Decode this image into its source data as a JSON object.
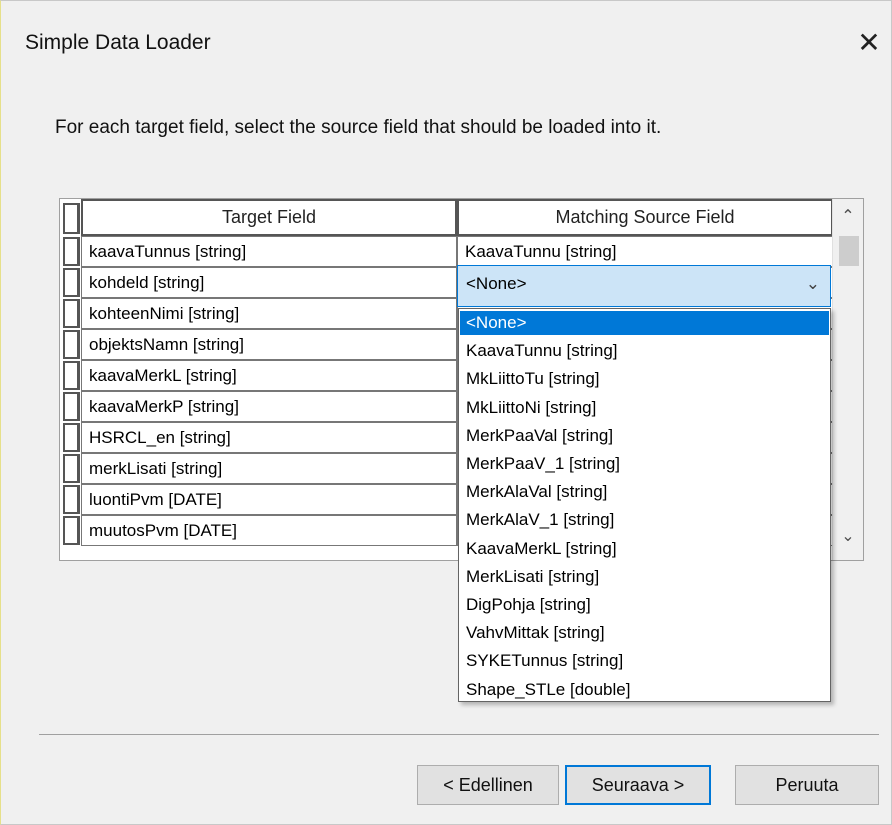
{
  "window": {
    "title": "Simple Data Loader",
    "close_glyph": "✕"
  },
  "instruction": "For each target field, select the source field that should be loaded into it.",
  "grid": {
    "headers": {
      "target": "Target Field",
      "source": "Matching Source Field"
    },
    "rows": [
      {
        "target": "kaavaTunnus [string]",
        "source": "KaavaTunnu [string]"
      },
      {
        "target": "kohdeld [string]",
        "source": "<None>"
      },
      {
        "target": "kohteenNimi [string]",
        "source": ""
      },
      {
        "target": "objektsNamn [string]",
        "source": ""
      },
      {
        "target": "kaavaMerkL [string]",
        "source": ""
      },
      {
        "target": "kaavaMerkP [string]",
        "source": ""
      },
      {
        "target": "HSRCL_en [string]",
        "source": ""
      },
      {
        "target": "merkLisati [string]",
        "source": ""
      },
      {
        "target": "luontiPvm [DATE]",
        "source": ""
      },
      {
        "target": "muutosPvm [DATE]",
        "source": ""
      }
    ],
    "scroll_up": "⌃",
    "scroll_down": "⌄"
  },
  "combo": {
    "value": "<None>",
    "chevron": "⌄"
  },
  "dropdown": {
    "selected_index": 0,
    "options": [
      "<None>",
      "KaavaTunnu [string]",
      "MkLiittoTu [string]",
      "MkLiittoNi [string]",
      "MerkPaaVal [string]",
      "MerkPaaV_1 [string]",
      "MerkAlaVal [string]",
      "MerkAlaV_1 [string]",
      "KaavaMerkL [string]",
      "MerkLisati [string]",
      "DigPohja [string]",
      "VahvMittak [string]",
      "SYKETunnus [string]",
      "Shape_STLe [double]"
    ]
  },
  "buttons": {
    "back": "< Edellinen",
    "next": "Seuraava >",
    "cancel": "Peruuta"
  },
  "colors": {
    "accent": "#0078d7",
    "combo_bg": "#cce4f7",
    "window_bg": "#f0f0f0"
  }
}
